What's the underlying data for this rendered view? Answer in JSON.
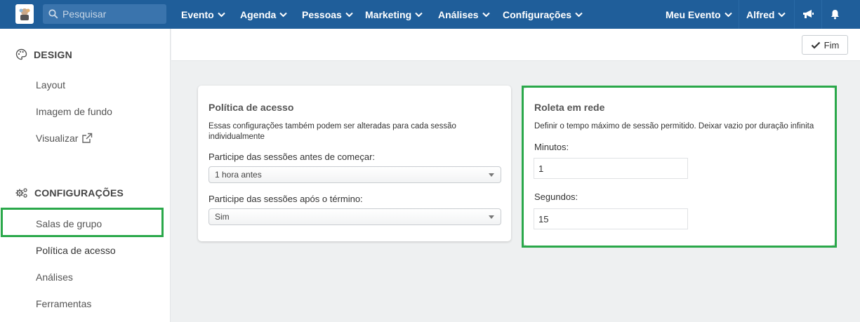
{
  "search": {
    "placeholder": "Pesquisar"
  },
  "nav": {
    "items": [
      {
        "label": "Evento"
      },
      {
        "label": "Agenda"
      },
      {
        "label": "Pessoas"
      },
      {
        "label": "Marketing"
      },
      {
        "label": "Análises"
      },
      {
        "label": "Configurações"
      }
    ],
    "right": [
      {
        "label": "Meu Evento"
      },
      {
        "label": "Alfred"
      }
    ]
  },
  "sidebar": {
    "design": {
      "title": "DESIGN",
      "items": [
        {
          "label": "Layout"
        },
        {
          "label": "Imagem de fundo"
        },
        {
          "label": "Visualizar"
        }
      ]
    },
    "config": {
      "title": "CONFIGURAÇÕES",
      "items": [
        {
          "label": "Salas de grupo"
        },
        {
          "label": "Política de acesso"
        },
        {
          "label": "Análises"
        },
        {
          "label": "Ferramentas"
        }
      ]
    }
  },
  "header": {
    "done_label": "Fim"
  },
  "access_card": {
    "title": "Política de acesso",
    "desc": "Essas configurações também podem ser alteradas para cada sessão individualmente",
    "before_label": "Participe das sessões antes de começar:",
    "before_value": "1 hora antes",
    "after_label": "Participe das sessões após o término:",
    "after_value": "Sim"
  },
  "roulette_card": {
    "title": "Roleta em rede",
    "desc": "Definir o tempo máximo de sessão permitido. Deixar vazio por duração infinita",
    "minutes_label": "Minutos:",
    "minutes_value": "1",
    "seconds_label": "Segundos:",
    "seconds_value": "15"
  },
  "colors": {
    "nav_bg": "#1f5e9a",
    "highlight": "#2aa84a"
  }
}
